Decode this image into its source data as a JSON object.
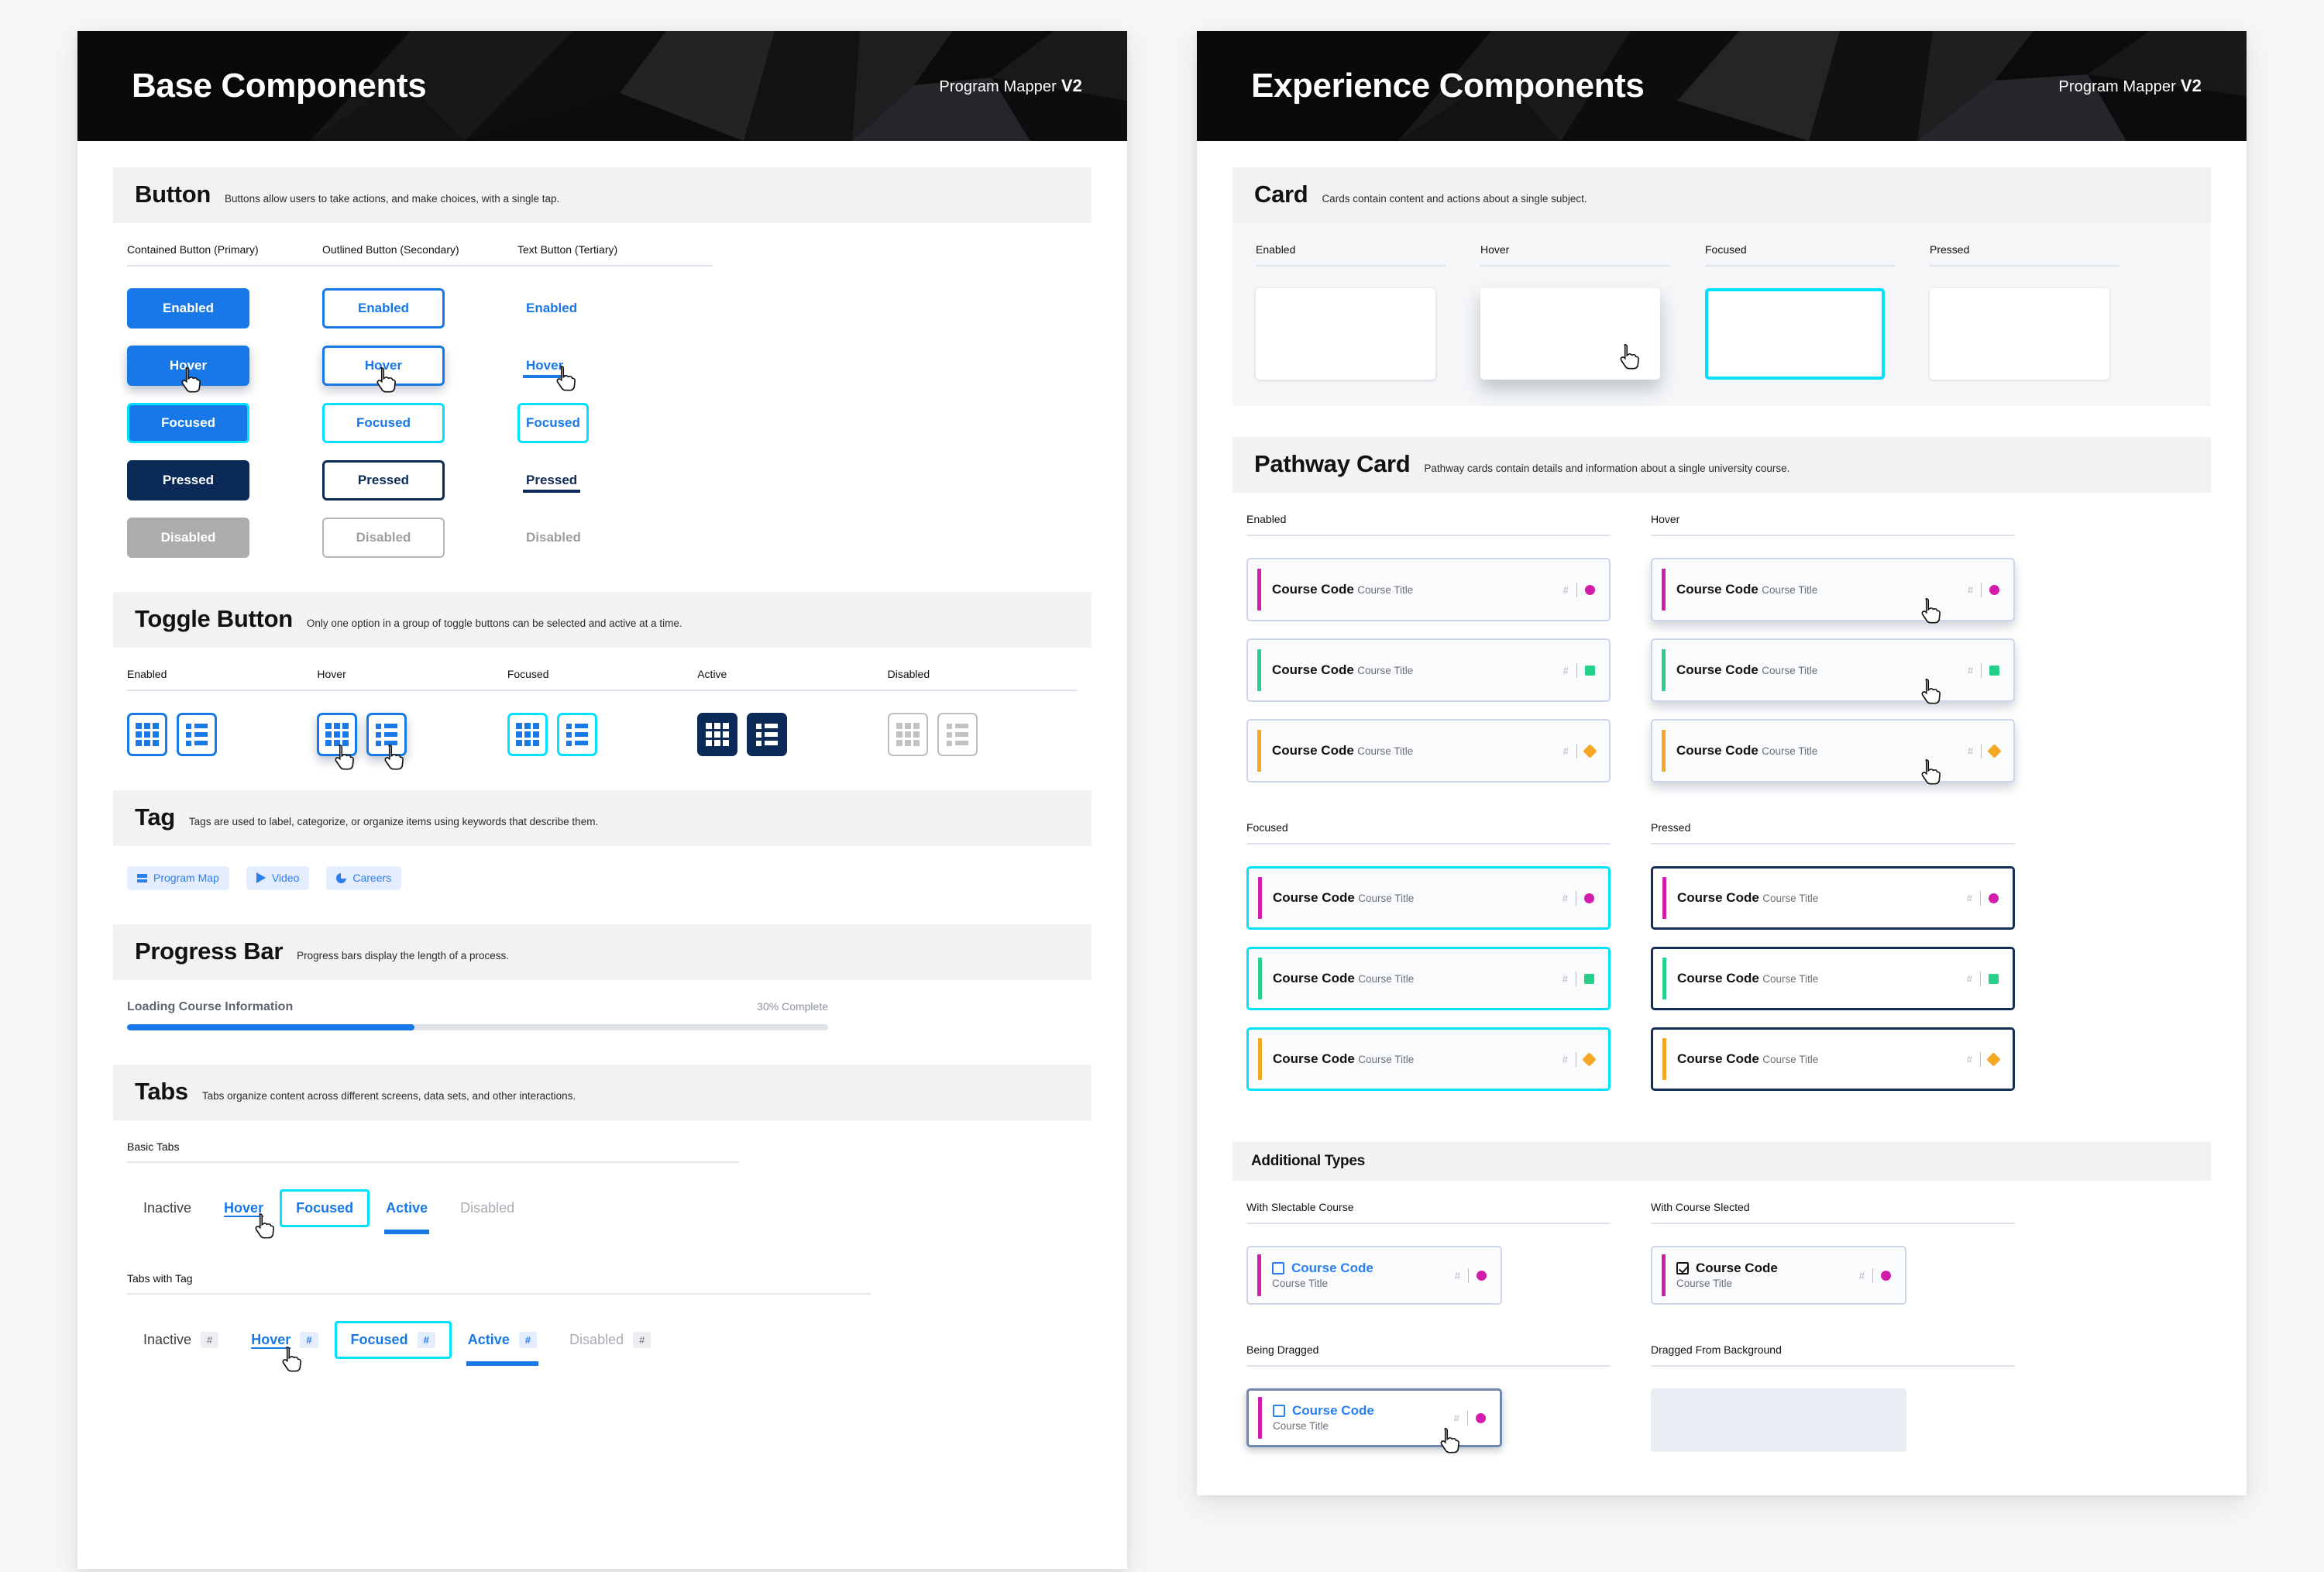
{
  "colors": {
    "primary": "#1878e8",
    "focus_cyan": "#00e1ff",
    "pressed_navy": "#0c2a58",
    "disabled_gray": "#acacac",
    "tag_bg": "#e3edfd",
    "magenta": "#d21cac",
    "green": "#25d08a",
    "amber": "#f5a623"
  },
  "panels": {
    "base": {
      "banner": {
        "title": "Base Components",
        "product": "Program Mapper",
        "version": "V2"
      },
      "button": {
        "title": "Button",
        "desc": "Buttons allow users to take actions, and make choices, with a single tap.",
        "columns": [
          {
            "label": "Contained Button (Primary)"
          },
          {
            "label": "Outlined Button (Secondary)"
          },
          {
            "label": "Text Button (Tertiary)"
          }
        ],
        "states": [
          "Enabled",
          "Hover",
          "Focused",
          "Pressed",
          "Disabled"
        ]
      },
      "toggle": {
        "title": "Toggle Button",
        "desc": "Only one option in a group of toggle buttons can be selected and active at a time.",
        "columns": [
          "Enabled",
          "Hover",
          "Focused",
          "Active",
          "Disabled"
        ],
        "icons": [
          "grid-icon",
          "list-icon"
        ]
      },
      "tag": {
        "title": "Tag",
        "desc": "Tags are used to label, categorize, or organize items using keywords that describe them.",
        "items": [
          {
            "label": "Program Map",
            "icon": "bars-icon"
          },
          {
            "label": "Video",
            "icon": "play-icon"
          },
          {
            "label": "Careers",
            "icon": "pie-chart-icon"
          }
        ]
      },
      "progress": {
        "title": "Progress Bar",
        "desc": "Progress bars display the length of a process.",
        "label": "Loading Course Information",
        "percent_label": "30% Complete",
        "percent": 30,
        "fill_ratio": 41
      },
      "tabs": {
        "title": "Tabs",
        "desc": "Tabs organize content across different screens, data sets, and other interactions.",
        "basic_label": "Basic Tabs",
        "with_tag_label": "Tabs with Tag",
        "items": [
          "Inactive",
          "Hover",
          "Focused",
          "Active",
          "Disabled"
        ],
        "badge": "#"
      }
    },
    "experience": {
      "banner": {
        "title": "Experience Components",
        "product": "Program Mapper",
        "version": "V2"
      },
      "card": {
        "title": "Card",
        "desc": "Cards contain content and actions about a single subject.",
        "columns": [
          "Enabled",
          "Hover",
          "Focused",
          "Pressed"
        ]
      },
      "pathway": {
        "title": "Pathway Card",
        "desc": "Pathway cards contain details and information about a single university course.",
        "columns": [
          "Enabled",
          "Hover",
          "Focused",
          "Pressed"
        ],
        "course": {
          "code": "Course Code",
          "title": "Course Title",
          "hash": "#"
        },
        "markers": [
          {
            "shape": "circle",
            "color": "#d21cac"
          },
          {
            "shape": "square",
            "color": "#25d08a"
          },
          {
            "shape": "diamond",
            "color": "#f5a623"
          }
        ]
      },
      "additional": {
        "title": "Additional Types",
        "labels": {
          "selectable": "With Slectable Course",
          "selected": "With Course Slected",
          "dragging": "Being Dragged",
          "dragged_from": "Dragged From Background"
        }
      }
    }
  }
}
